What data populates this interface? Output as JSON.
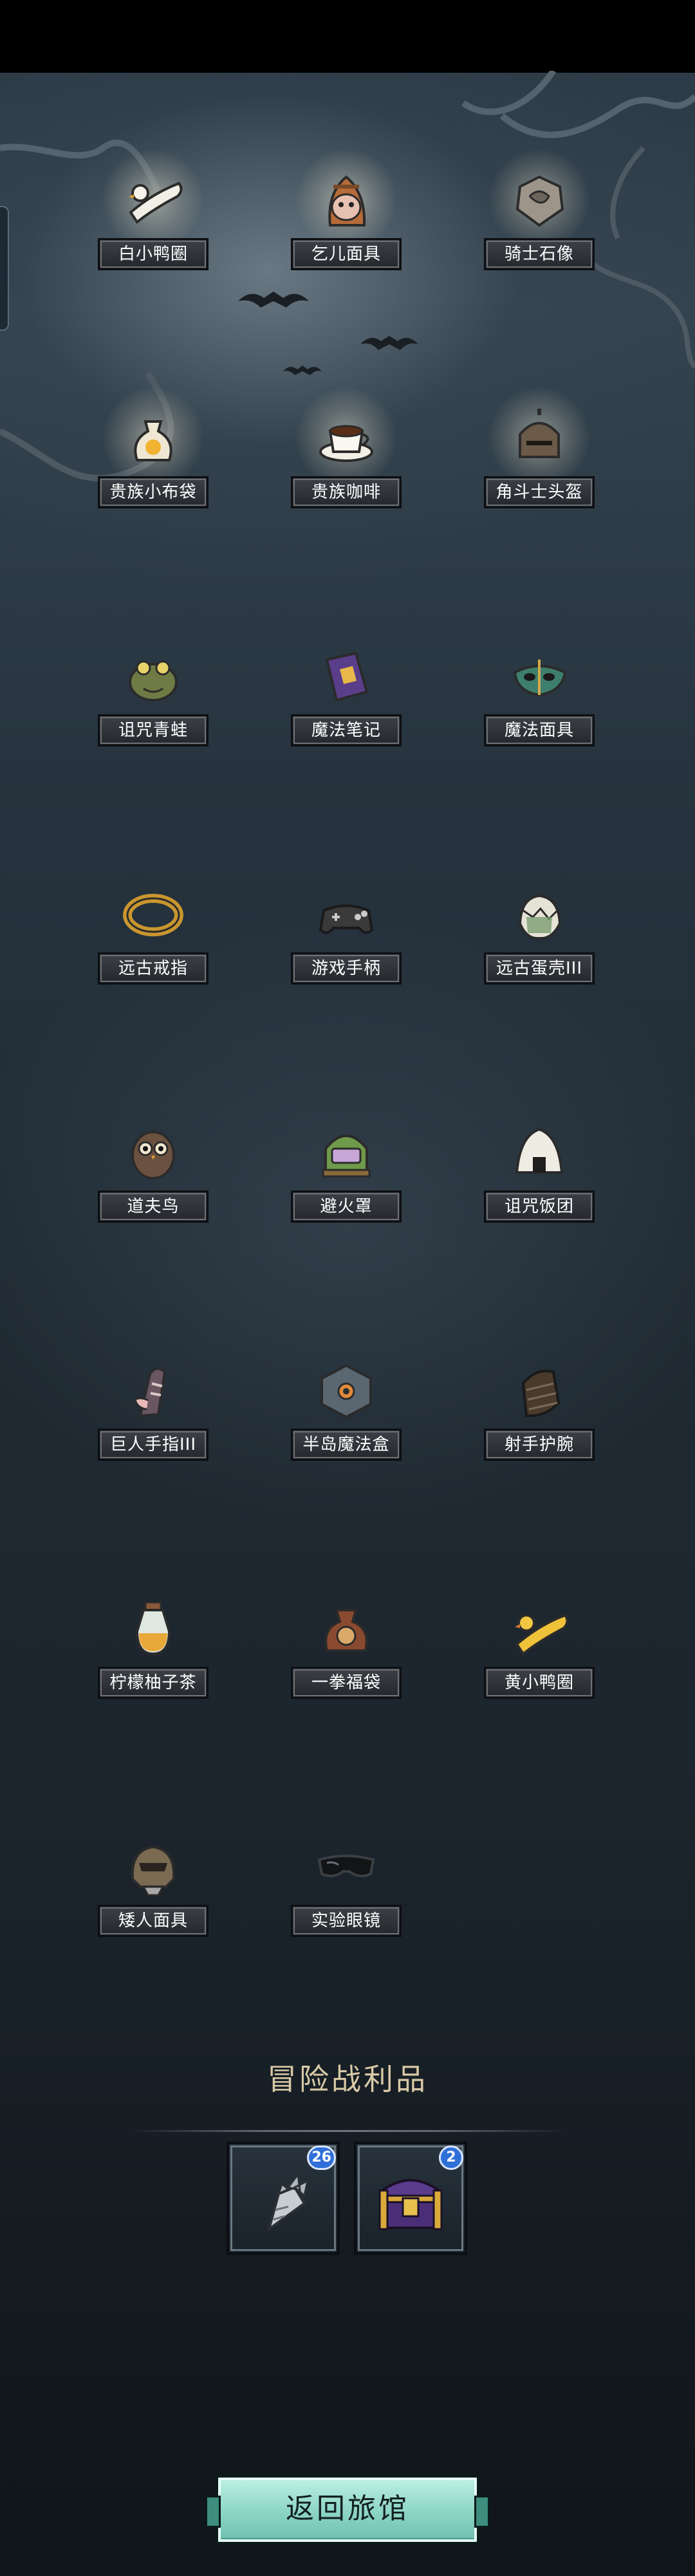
{
  "collection": {
    "rows": [
      [
        {
          "name": "白小鸭圈",
          "icon": "white-duck-ring-icon",
          "glow": true
        },
        {
          "name": "乞儿面具",
          "icon": "beggar-mask-icon",
          "glow": true
        },
        {
          "name": "骑士石像",
          "icon": "knight-statue-icon",
          "glow": true
        }
      ],
      [
        {
          "name": "贵族小布袋",
          "icon": "noble-pouch-icon",
          "glow": true
        },
        {
          "name": "贵族咖啡",
          "icon": "noble-coffee-icon",
          "glow": true
        },
        {
          "name": "角斗士头盔",
          "icon": "gladiator-helmet-icon",
          "glow": true
        }
      ],
      [
        {
          "name": "诅咒青蛙",
          "icon": "cursed-frog-icon",
          "glow": false
        },
        {
          "name": "魔法笔记",
          "icon": "magic-notebook-icon",
          "glow": false
        },
        {
          "name": "魔法面具",
          "icon": "magic-mask-icon",
          "glow": false
        }
      ],
      [
        {
          "name": "远古戒指",
          "icon": "ancient-ring-icon",
          "glow": false
        },
        {
          "name": "游戏手柄",
          "icon": "gamepad-icon",
          "glow": false
        },
        {
          "name": "远古蛋壳III",
          "icon": "ancient-eggshell-icon",
          "glow": false
        }
      ],
      [
        {
          "name": "道夫鸟",
          "icon": "owl-icon",
          "glow": false
        },
        {
          "name": "避火罩",
          "icon": "fire-shield-helmet-icon",
          "glow": false
        },
        {
          "name": "诅咒饭团",
          "icon": "cursed-riceball-icon",
          "glow": false
        }
      ],
      [
        {
          "name": "巨人手指III",
          "icon": "giant-finger-icon",
          "glow": false
        },
        {
          "name": "半岛魔法盒",
          "icon": "magic-box-icon",
          "glow": false
        },
        {
          "name": "射手护腕",
          "icon": "archer-bracer-icon",
          "glow": false
        }
      ],
      [
        {
          "name": "柠檬柚子茶",
          "icon": "lemon-tea-icon",
          "glow": false
        },
        {
          "name": "一拳福袋",
          "icon": "lucky-bag-icon",
          "glow": false
        },
        {
          "name": "黄小鸭圈",
          "icon": "yellow-duck-ring-icon",
          "glow": false
        }
      ],
      [
        {
          "name": "矮人面具",
          "icon": "dwarf-mask-icon",
          "glow": false
        },
        {
          "name": "实验眼镜",
          "icon": "lab-goggles-icon",
          "glow": false
        }
      ]
    ]
  },
  "loot": {
    "title": "冒险战利品",
    "items": [
      {
        "icon": "carrot-icon",
        "count": "26"
      },
      {
        "icon": "treasure-chest-icon",
        "count": "2"
      }
    ]
  },
  "footer": {
    "return_label": "返回旅馆"
  }
}
